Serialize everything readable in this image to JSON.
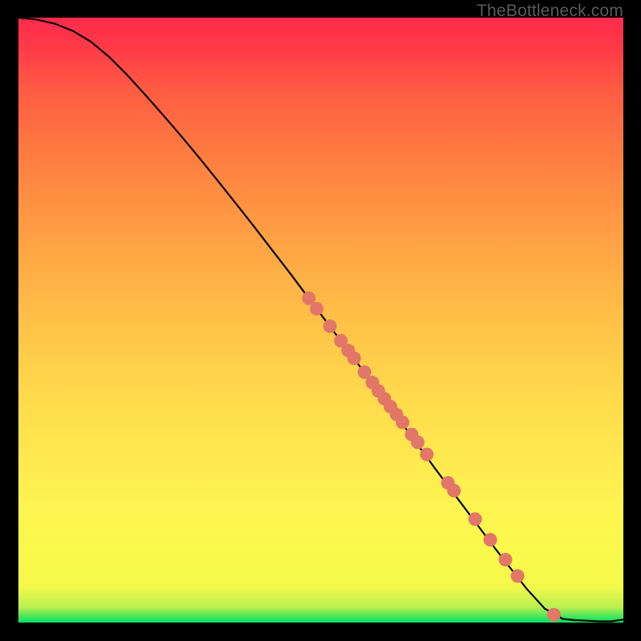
{
  "watermark": "TheBottleneck.com",
  "chart_data": {
    "type": "line",
    "title": "",
    "xlabel": "",
    "ylabel": "",
    "xlim": [
      0,
      100
    ],
    "ylim": [
      0,
      100
    ],
    "grid": false,
    "series": [
      {
        "name": "curve",
        "x": [
          0,
          3,
          6,
          9,
          12,
          15,
          18,
          21,
          24,
          27,
          30,
          33,
          36,
          39,
          42,
          45,
          48,
          51,
          54,
          57,
          60,
          63,
          66,
          69,
          72,
          75,
          78,
          81,
          84,
          87,
          90,
          92,
          94,
          96,
          98,
          100
        ],
        "y": [
          100,
          99.7,
          99.0,
          97.8,
          96.0,
          93.5,
          90.5,
          87.2,
          83.8,
          80.3,
          76.7,
          73.0,
          69.2,
          65.4,
          61.5,
          57.6,
          53.6,
          49.6,
          45.6,
          41.6,
          37.5,
          33.5,
          29.4,
          25.3,
          21.3,
          17.3,
          13.3,
          9.4,
          5.6,
          2.3,
          0.6,
          0.4,
          0.3,
          0.2,
          0.2,
          0.5
        ]
      }
    ],
    "marker_points": [
      {
        "x": 48.0,
        "y": 53.6
      },
      {
        "x": 49.3,
        "y": 51.9
      },
      {
        "x": 51.5,
        "y": 49.0
      },
      {
        "x": 53.3,
        "y": 46.6
      },
      {
        "x": 54.5,
        "y": 45.0
      },
      {
        "x": 55.5,
        "y": 43.7
      },
      {
        "x": 57.2,
        "y": 41.4
      },
      {
        "x": 58.5,
        "y": 39.7
      },
      {
        "x": 59.5,
        "y": 38.3
      },
      {
        "x": 60.5,
        "y": 37.0
      },
      {
        "x": 61.5,
        "y": 35.7
      },
      {
        "x": 62.5,
        "y": 34.4
      },
      {
        "x": 63.5,
        "y": 33.1
      },
      {
        "x": 65.0,
        "y": 31.1
      },
      {
        "x": 66.0,
        "y": 29.8
      },
      {
        "x": 67.5,
        "y": 27.8
      },
      {
        "x": 71.0,
        "y": 23.1
      },
      {
        "x": 72.0,
        "y": 21.8
      },
      {
        "x": 75.5,
        "y": 17.1
      },
      {
        "x": 78.0,
        "y": 13.7
      },
      {
        "x": 80.5,
        "y": 10.4
      },
      {
        "x": 82.5,
        "y": 7.7
      },
      {
        "x": 88.5,
        "y": 1.3
      }
    ],
    "colors": {
      "curve": "#000000",
      "markers": "#e27768"
    }
  }
}
